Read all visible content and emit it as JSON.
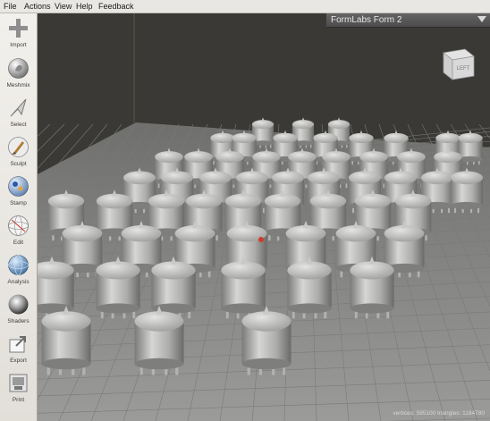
{
  "menu": [
    "File",
    "Actions",
    "View",
    "Help",
    "Feedback"
  ],
  "toolbar": [
    {
      "label": "Import",
      "icon": "plus-icon"
    },
    {
      "label": "Meshmix",
      "icon": "bunny-sphere-icon"
    },
    {
      "label": "Select",
      "icon": "cursor-arrow-icon"
    },
    {
      "label": "Sculpt",
      "icon": "brush-icon"
    },
    {
      "label": "Stamp",
      "icon": "stamp-sphere-icon"
    },
    {
      "label": "Edit",
      "icon": "wire-sphere-icon"
    },
    {
      "label": "Analysis",
      "icon": "analysis-sphere-icon"
    },
    {
      "label": "Shaders",
      "icon": "chrome-sphere-icon"
    },
    {
      "label": "Export",
      "icon": "export-arrow-icon"
    },
    {
      "label": "Print",
      "icon": "printer-icon"
    }
  ],
  "printer": {
    "name": "FormLabs Form 2"
  },
  "viewcube": {
    "face": "LEFT"
  },
  "status": {
    "text": "vertices: 595100 triangles: 1184780"
  },
  "colors": {
    "menubar": "#e9e7e3",
    "background": "#3b3935",
    "plate": "#8f8f8d",
    "model": "#b4b4b2",
    "printer_bar": "#555555"
  },
  "scene": {
    "model_shape": "cylinder-cap-on-legs",
    "model_rows": 8
  }
}
